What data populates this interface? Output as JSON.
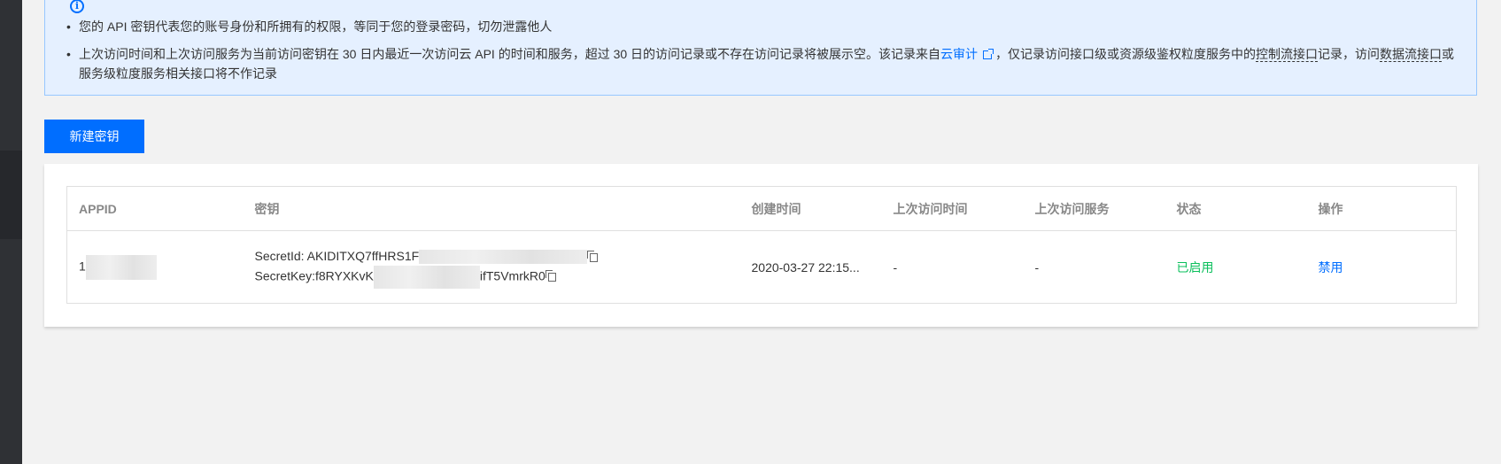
{
  "notice": {
    "items": [
      {
        "text": "您的 API 密钥代表您的账号身份和所拥有的权限，等同于您的登录密码，切勿泄露他人"
      },
      {
        "part1": "上次访问时间和上次访问服务为当前访问密钥在 30 日内最近一次访问云 API 的时间和服务，超过 30 日的访问记录或不存在访问记录将被展示空。该记录来自",
        "link": "云审计",
        "part2": "，仅记录访问接口级或资源级鉴权粒度服务中的",
        "term1": "控制流接口",
        "part3": "记录，访问",
        "term2": "数据流接口",
        "part4": "或服务级粒度服务相关接口将不作记录"
      }
    ]
  },
  "toolbar": {
    "new_key_label": "新建密钥"
  },
  "table": {
    "headers": [
      "APPID",
      "密钥",
      "创建时间",
      "上次访问时间",
      "上次访问服务",
      "状态",
      "操作"
    ],
    "rows": [
      {
        "appid": "1",
        "secret_id_prefix": "SecretId: AKIDITXQ7ffHRS1F",
        "secret_key_prefix": "SecretKey:f8RYXKvK",
        "secret_key_suffix": "ifT5VmrkR0",
        "created": "2020-03-27 22:15...",
        "last_access_time": "-",
        "last_access_service": "-",
        "status": "已启用",
        "action": "禁用"
      }
    ]
  },
  "colors": {
    "accent": "#006eff",
    "status_enabled": "#0abf5b",
    "notice_bg": "#e5f0ff"
  },
  "icons": [
    "info-icon",
    "external-link-icon",
    "copy-icon"
  ]
}
